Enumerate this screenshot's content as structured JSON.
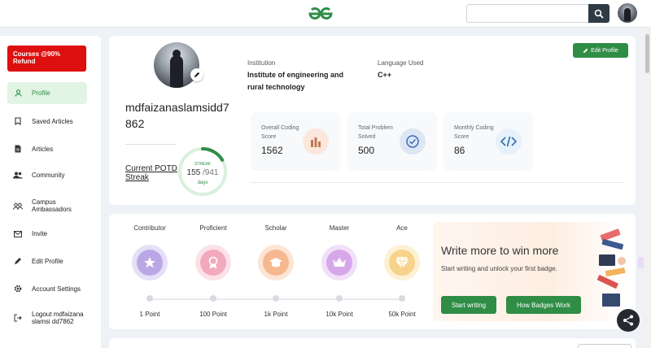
{
  "header": {
    "logo_icon": "geeksforgeeks-logo-icon",
    "search_placeholder": "",
    "search_icon": "search-icon",
    "brand_color": "#2f8d46"
  },
  "sidebar": {
    "promo_label": "Courses @90% Refund",
    "items": [
      {
        "label": "Profile",
        "icon": "user-icon",
        "active": true
      },
      {
        "label": "Saved Articles",
        "icon": "bookmark-icon"
      },
      {
        "label": "Articles",
        "icon": "document-icon"
      },
      {
        "label": "Community",
        "icon": "people-icon"
      },
      {
        "label": "Campus Ambassadors",
        "icon": "group-icon"
      },
      {
        "label": "Invite",
        "icon": "mail-icon"
      },
      {
        "label": "Edit Profile",
        "icon": "pencil-icon"
      },
      {
        "label": "Account Settings",
        "icon": "gear-icon"
      },
      {
        "label": "Logout mdfaizanaslamsi dd7862",
        "icon": "logout-icon"
      }
    ]
  },
  "profile": {
    "username": "mdfaizanaslamsidd7862",
    "potd_label": "Current POTD Streak",
    "streak_label": "STREAK",
    "streak_current": "155",
    "streak_total": "/941",
    "streak_unit": "days",
    "streak_fraction": 0.165,
    "institution_label": "Institution",
    "institution_value": "Institute of engineering and rural technology",
    "language_label": "Language Used",
    "language_value": "C++",
    "edit_button": "Edit Profile",
    "stats": [
      {
        "label": "Overall Coding Score",
        "value": "1562",
        "icon": "bar-chart-icon",
        "color": "#e07b39"
      },
      {
        "label": "Total Problem Solved",
        "value": "500",
        "icon": "check-circle-icon",
        "color": "#3b6fb6"
      },
      {
        "label": "Monthly Coding Score",
        "value": "86",
        "icon": "code-icon",
        "color": "#3b8fd6"
      }
    ]
  },
  "badges": {
    "items": [
      {
        "name": "Contributor",
        "points": "1 Point",
        "icon": "star-icon",
        "color": "#b9a7e6"
      },
      {
        "name": "Proficient",
        "points": "100 Point",
        "icon": "ribbon-icon",
        "color": "#f2a9bd"
      },
      {
        "name": "Scholar",
        "points": "1k Point",
        "icon": "graduation-cap-icon",
        "color": "#f6b98f"
      },
      {
        "name": "Master",
        "points": "10k Point",
        "icon": "crown-icon",
        "color": "#d6a8ea"
      },
      {
        "name": "Ace",
        "points": "50k Point",
        "icon": "diamond-icon",
        "color": "#f7d28a"
      }
    ],
    "write_title": "Write more to win more",
    "write_subtitle": "Start writing and unlock your first badge.",
    "start_writing": "Start writing",
    "how_badges_work": "How Badges Work"
  },
  "floating": {
    "share_icon": "share-icon"
  }
}
